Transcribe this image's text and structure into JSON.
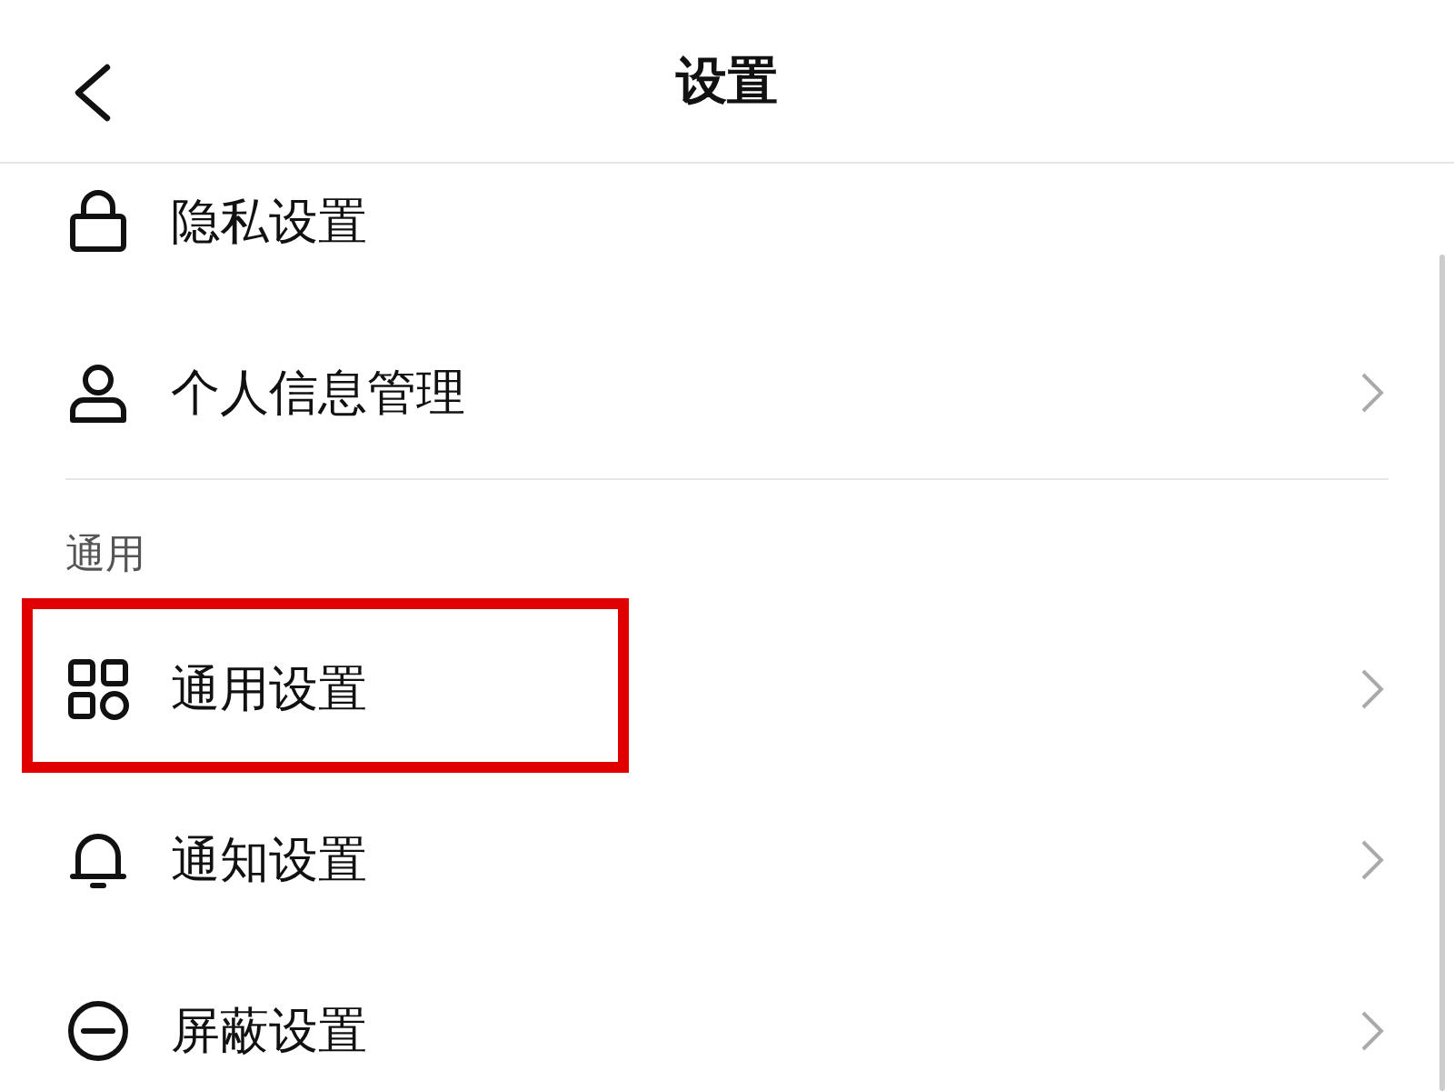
{
  "header": {
    "title": "设置"
  },
  "sections": [
    {
      "items": [
        {
          "label": "隐私设置",
          "chevron": false,
          "highlighted": false
        },
        {
          "label": "个人信息管理",
          "chevron": true,
          "highlighted": false
        }
      ]
    },
    {
      "label": "通用",
      "items": [
        {
          "label": "通用设置",
          "chevron": true,
          "highlighted": true
        },
        {
          "label": "通知设置",
          "chevron": true,
          "highlighted": false
        },
        {
          "label": "屏蔽设置",
          "chevron": true,
          "highlighted": false
        }
      ]
    }
  ]
}
